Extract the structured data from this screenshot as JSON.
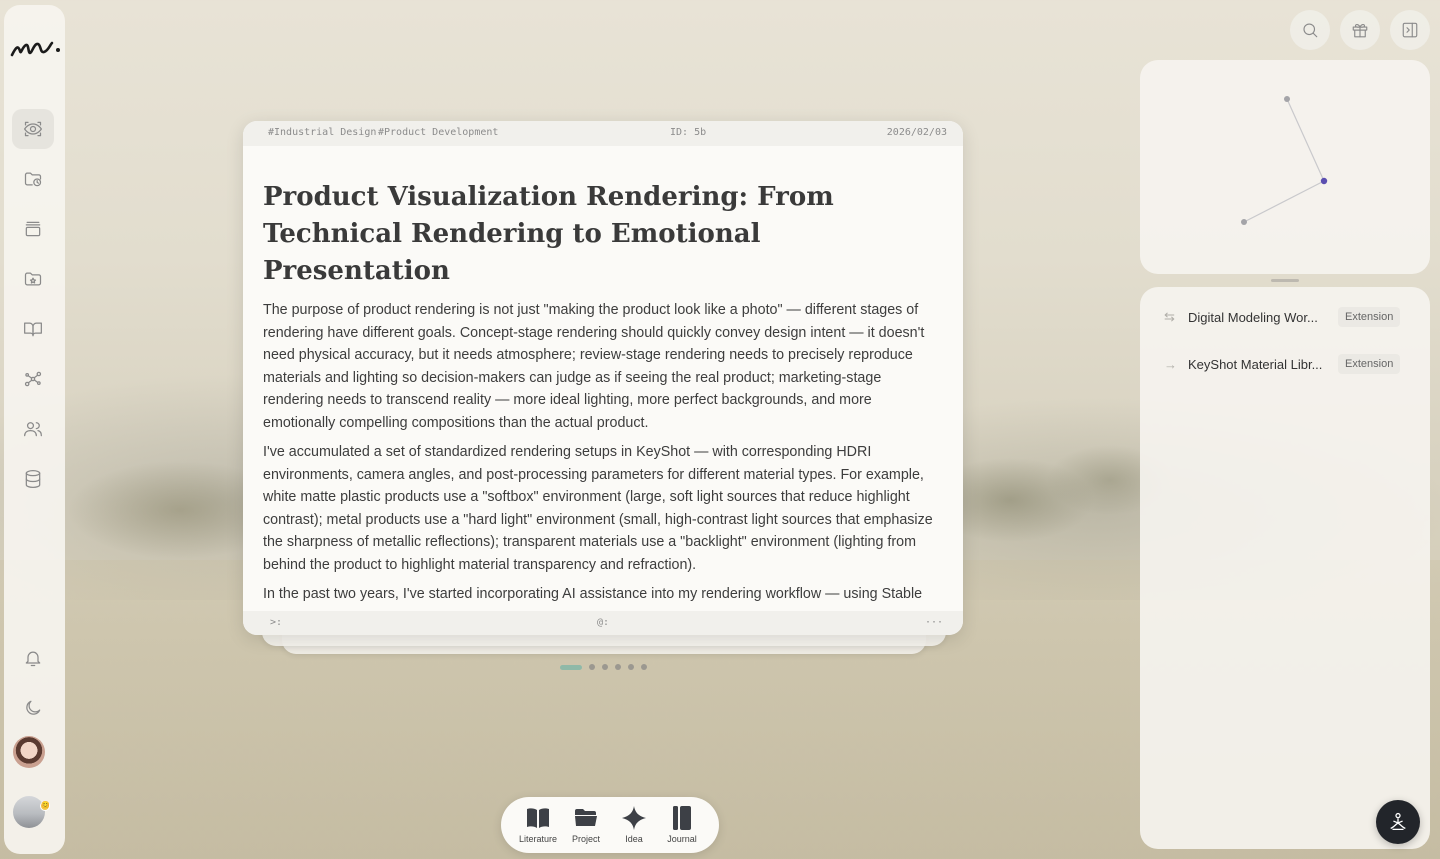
{
  "sidebar": {
    "logo": "m.",
    "nav": [
      {
        "name": "eye-icon"
      },
      {
        "name": "folder-clock-icon"
      },
      {
        "name": "layers-icon"
      },
      {
        "name": "folder-star-icon"
      },
      {
        "name": "book-open-icon"
      },
      {
        "name": "graph-icon"
      },
      {
        "name": "users-icon"
      },
      {
        "name": "database-icon"
      }
    ],
    "bottom": [
      {
        "name": "bell-icon"
      },
      {
        "name": "moon-icon"
      }
    ],
    "badge": "😊"
  },
  "topbar": {
    "buttons": [
      "search-icon",
      "gift-icon",
      "panel-toggle-icon"
    ]
  },
  "card": {
    "tags": [
      "#Industrial Design",
      "#Product Development"
    ],
    "id": "ID: 5b",
    "date": "2026/02/03",
    "title": "Product Visualization Rendering: From Technical Rendering to Emotional Presentation",
    "paragraphs": [
      "The purpose of product rendering is not just \"making the product look like a photo\" — different stages of rendering have different goals. Concept-stage rendering should quickly convey design intent — it doesn't need physical accuracy, but it needs atmosphere; review-stage rendering needs to precisely reproduce materials and lighting so decision-makers can judge as if seeing the real product; marketing-stage rendering needs to transcend reality — more ideal lighting, more perfect backgrounds, and more emotionally compelling compositions than the actual product.",
      "I've accumulated a set of standardized rendering setups in KeyShot — with corresponding HDRI environments, camera angles, and post-processing parameters for different material types. For example, white matte plastic products use a \"softbox\" environment (large, soft light sources that reduce highlight contrast); metal products use a \"hard light\" environment (small, high-contrast light sources that emphasize the sharpness of metallic reflections); transparent materials use a \"backlight\" environment (lighting from behind the product to highlight material transparency and refraction).",
      "In the past two years, I've started incorporating AI assistance into my rendering workflow — using Stable"
    ],
    "footer_left": ">:",
    "footer_mid": "@:",
    "footer_right": "···"
  },
  "pager": {
    "total": 6,
    "active": 0
  },
  "links": [
    {
      "icon": "bidirectional-arrow-icon",
      "title": "Digital Modeling Wor...",
      "tag": "Extension"
    },
    {
      "icon": "arrow-right-icon",
      "title": "KeyShot Material Libr...",
      "tag": "Extension"
    }
  ],
  "dock": [
    {
      "label": "Literature",
      "icon": "book-icon"
    },
    {
      "label": "Project",
      "icon": "folder-icon"
    },
    {
      "label": "Idea",
      "icon": "sparkle-icon"
    },
    {
      "label": "Journal",
      "icon": "journal-icon"
    }
  ],
  "colors": {
    "accent": "#8fb9a8",
    "graph_node_active": "#5b4fb0"
  }
}
